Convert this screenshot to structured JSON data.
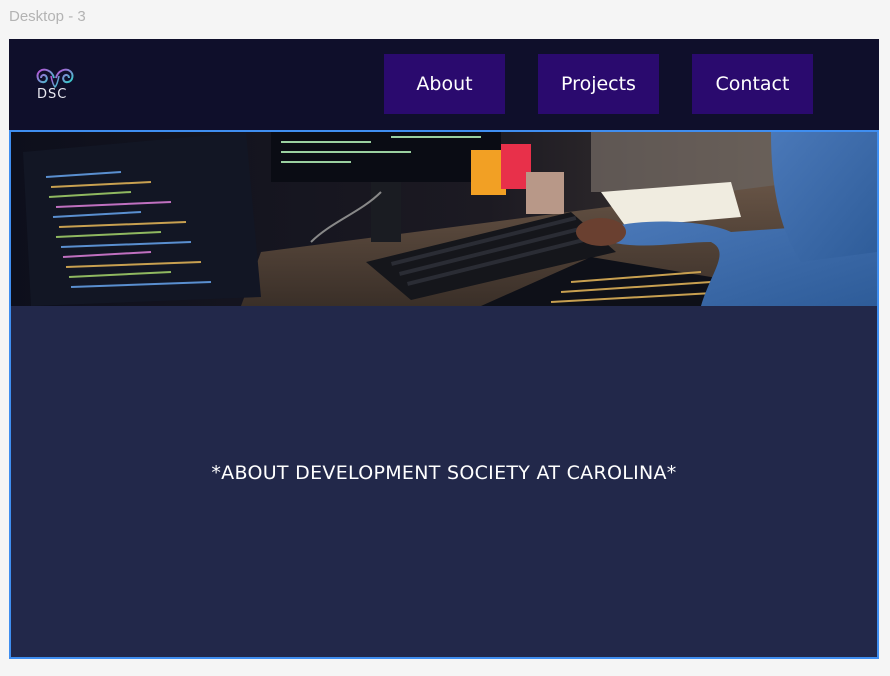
{
  "canvas": {
    "frame_label": "Desktop - 3"
  },
  "header": {
    "logo_text": "DSC",
    "nav": [
      {
        "label": "About"
      },
      {
        "label": "Projects"
      },
      {
        "label": "Contact"
      }
    ]
  },
  "main": {
    "hero_image": "developer-workspace-photo",
    "about_text": "*ABOUT DEVELOPMENT SOCIETY AT CAROLINA*"
  },
  "colors": {
    "navbar_bg": "#0f0f2b",
    "nav_button_bg": "#2a0a6e",
    "content_bg": "#22284a",
    "selection_border": "#3f8ef0",
    "logo_gradient_start": "#c04cd8",
    "logo_gradient_end": "#2fd3c9"
  }
}
